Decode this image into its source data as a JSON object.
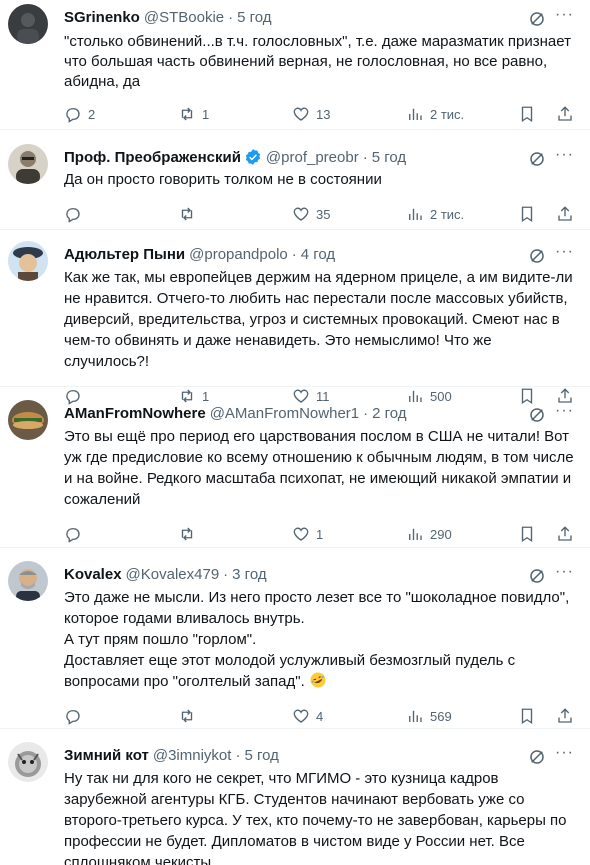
{
  "tweets": [
    {
      "name": "SGrinenko",
      "handle": "@STBookie",
      "time": "5 год",
      "text": "\"столько обвинений...в т.ч. голословных\", т.е. даже маразматик признает\nчто большая часть обвинений верная, не голословная, но все равно,\nабидна, да",
      "replies": "2",
      "retweets": "1",
      "likes": "13",
      "views": "2 тис.",
      "verified": false
    },
    {
      "name": "Проф. Преображенский",
      "handle": "@prof_preobr",
      "time": "5 год",
      "text": "Да он просто говорить толком не в состоянии",
      "replies": "",
      "retweets": "",
      "likes": "35",
      "views": "2 тис.",
      "verified": true
    },
    {
      "name": "Адюльтер Пыни",
      "handle": "@propandpolo",
      "time": "4 год",
      "text": "Как же так, мы европейцев держим на ядерном прицеле, а им видите-ли\nне нравится. Отчего-то любить нас перестали после массовых убийств,\nдиверсий, вредительства, угроз и системных провокаций. Смеют нас в\nчем-то обвинять и даже ненавидеть. Это немыслимо! Что же случилось?!",
      "replies": "",
      "retweets": "1",
      "likes": "11",
      "views": "500",
      "verified": false
    },
    {
      "name": "AManFromNowhere",
      "handle": "@AManFromNowher1",
      "time": "2 год",
      "text": "Это вы ещё про период его царствования послом в США не читали! Вот\nуж где предисловие ко всему отношению к обычным людям, в том числе\nи на войне. Редкого масштаба психопат, не имеющий никакой эмпатии и\nсожалений",
      "replies": "",
      "retweets": "",
      "likes": "1",
      "views": "290",
      "verified": false
    },
    {
      "name": "Kovalex",
      "handle": "@Kovalex479",
      "time": "3 год",
      "text": "Это даже не мысли. Из него просто лезет все то \"шоколадное повидло\",\nкоторое годами вливалось внутрь.\nА тут прям пошло \"горлом\".\nДоставляет еще этот молодой услужливый безмозглый пудель с\nвопросами про \"оголтелый запад\".",
      "replies": "",
      "retweets": "",
      "likes": "4",
      "views": "569",
      "verified": false
    },
    {
      "name": "Зимний кот",
      "handle": "@3imniykot",
      "time": "5 год",
      "text": "Ну так ни для кого не секрет, что МГИМО - это кузница кадров\nзарубежной агентуры КГБ. Студентов начинают вербовать уже со\nвторого-третьего курса. У тех, кто почему-то не завербован, карьеры по\nпрофессии не будет. Дипломатов в чистом виде у России нет. Все\nсплошняком чекисты.",
      "replies": "",
      "retweets": "",
      "likes": "",
      "views": "",
      "verified": false
    }
  ],
  "icons": {
    "reply": "reply-icon",
    "retweet": "retweet-icon",
    "like": "like-icon",
    "views": "views-icon",
    "bookmark": "bookmark-icon",
    "share": "share-icon",
    "grok": "grok-icon",
    "more": "more-icon",
    "emoji": "rofl-emoji"
  },
  "colors": {
    "text": "#0f1419",
    "secondary": "#536471",
    "verified": "#1d9bf0",
    "divider": "#eff3f4"
  }
}
